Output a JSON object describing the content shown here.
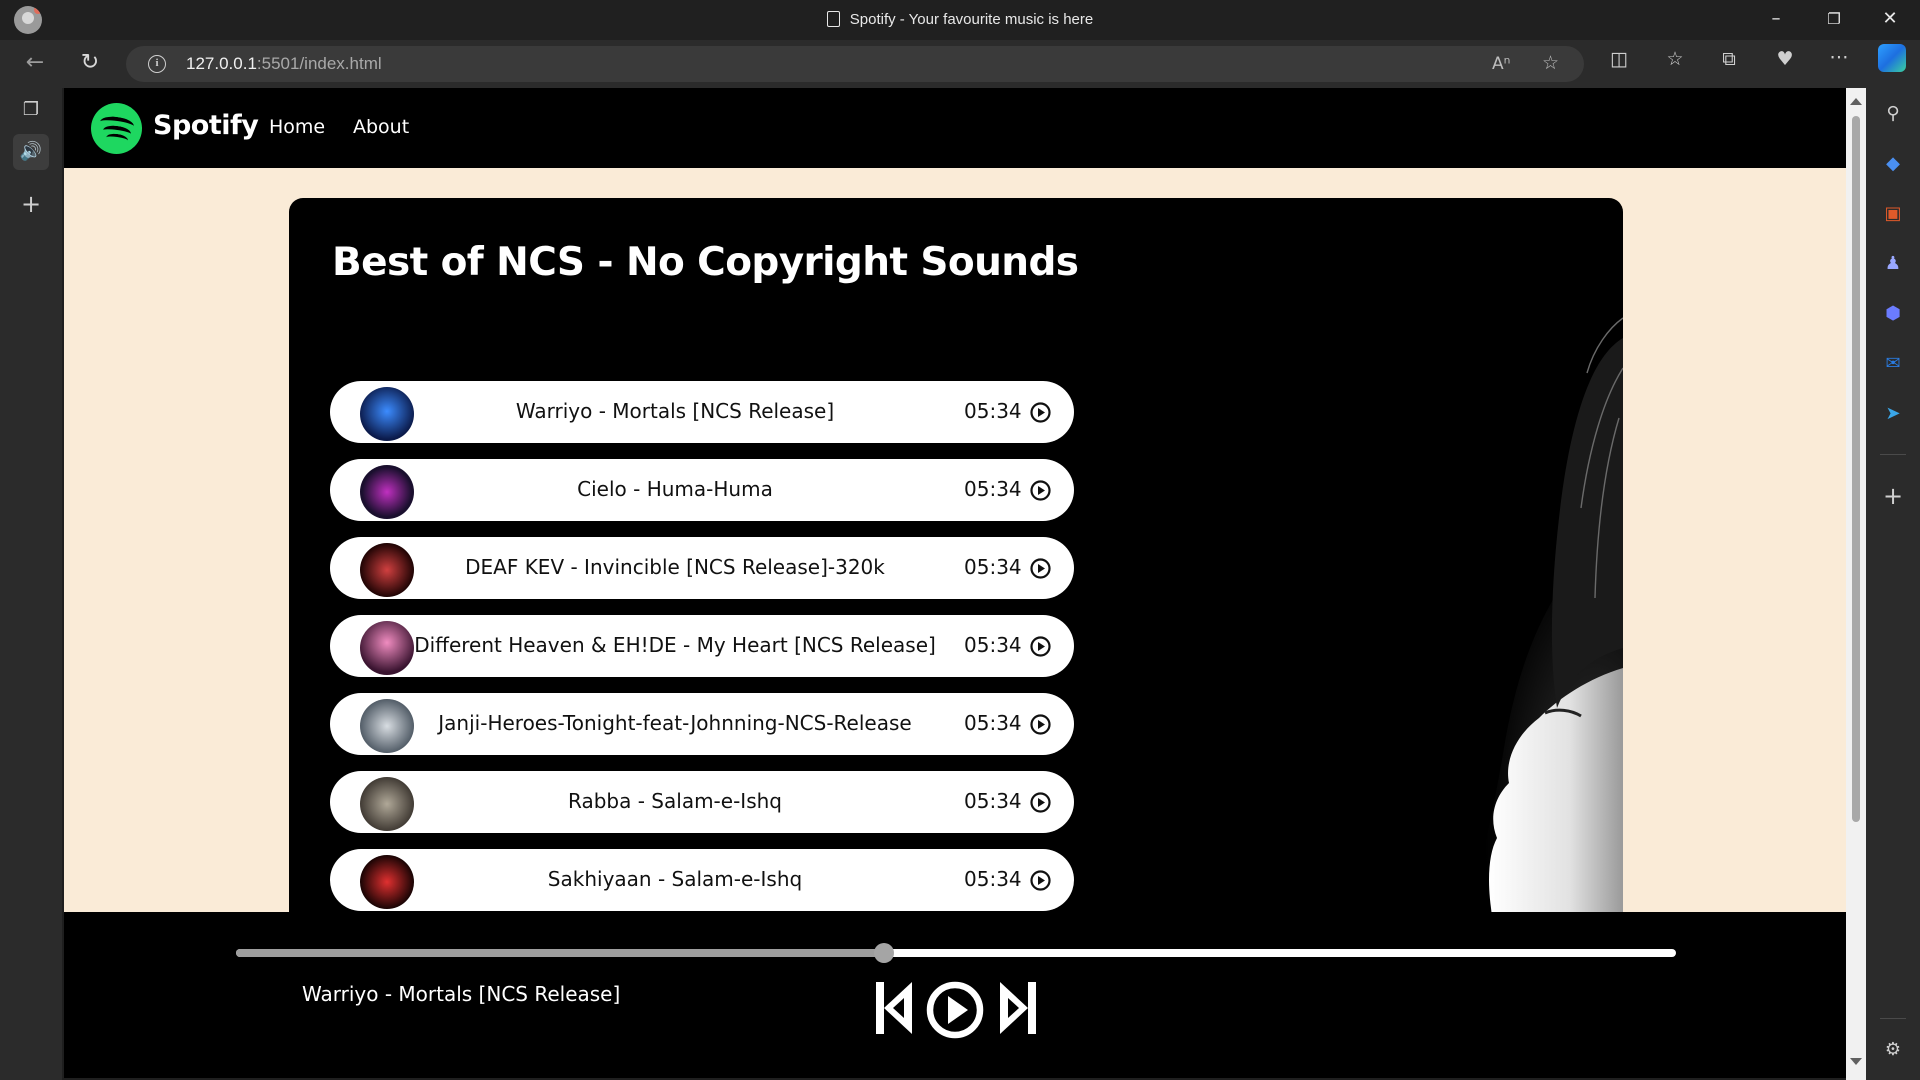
{
  "browser": {
    "tab_title": "Spotify - Your favourite music is here",
    "url_host": "127.0.0.1",
    "url_path": ":5501/index.html"
  },
  "site": {
    "brand": "Spotify",
    "nav": [
      "Home",
      "About"
    ],
    "brand_color": "#1ed760",
    "page_bg": "#faebd7"
  },
  "playlist": {
    "title": "Best of NCS - No Copyright Sounds",
    "songs": [
      {
        "name": "Warriyo - Mortals [NCS Release]",
        "duration": "05:34",
        "cover_color": "#1e3a8a"
      },
      {
        "name": "Cielo - Huma-Huma",
        "duration": "05:34",
        "cover_color": "#3b1f5c"
      },
      {
        "name": "DEAF KEV - Invincible [NCS Release]-320k",
        "duration": "05:34",
        "cover_color": "#5a0a0a"
      },
      {
        "name": "Different Heaven & EH!DE - My Heart [NCS Release]",
        "duration": "05:34",
        "cover_color": "#6b2c52"
      },
      {
        "name": "Janji-Heroes-Tonight-feat-Johnning-NCS-Release",
        "duration": "05:34",
        "cover_color": "#4a5560"
      },
      {
        "name": "Rabba - Salam-e-Ishq",
        "duration": "05:34",
        "cover_color": "#5a5048"
      },
      {
        "name": "Sakhiyaan - Salam-e-Ishq",
        "duration": "05:34",
        "cover_color": "#7a1010"
      }
    ]
  },
  "player": {
    "now_playing": "Warriyo - Mortals [NCS Release]",
    "progress_fraction": 0.45
  }
}
